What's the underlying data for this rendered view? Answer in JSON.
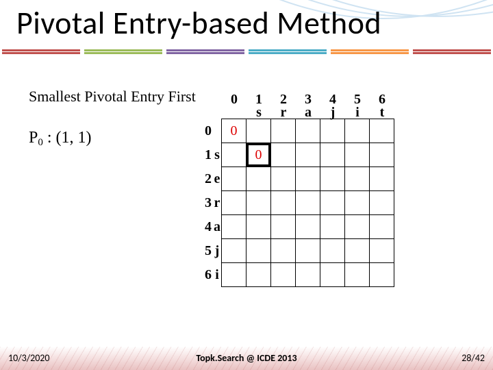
{
  "title": "Pivotal Entry-based Method",
  "subtitle": "Smallest Pivotal Entry First",
  "p0_prefix": "P",
  "p0_sub": "0",
  "p0_rest": " : (1, 1)",
  "matrix": {
    "col_index": [
      "0",
      "1",
      "2",
      "3",
      "4",
      "5",
      "6"
    ],
    "col_letters": [
      "",
      "s",
      "r",
      "a",
      "j",
      "i",
      "t"
    ],
    "row_index": [
      "0",
      "1",
      "2",
      "3",
      "4",
      "5",
      "6"
    ],
    "row_letters": [
      "",
      "s",
      "e",
      "r",
      "a",
      "j",
      "i"
    ],
    "cells": {
      "0_0": "0",
      "1_1": "0"
    },
    "highlight": "1_1"
  },
  "footer": {
    "date": "10/3/2020",
    "center": "Topk.Search @ ICDE 2013",
    "page": "28/42"
  },
  "underline_colors": [
    "#c0504d",
    "#9bbb59",
    "#8064a2",
    "#4bacc6",
    "#f79646",
    "#c44d58"
  ]
}
